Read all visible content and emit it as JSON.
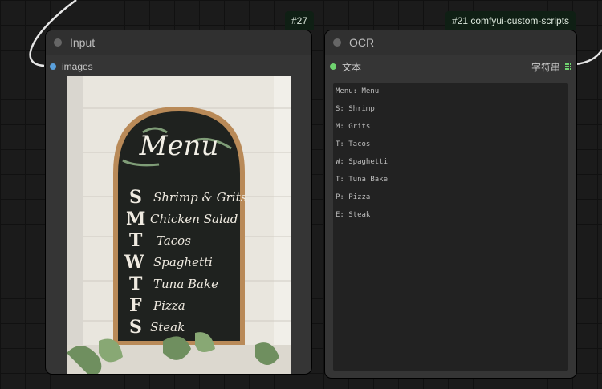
{
  "badges": {
    "input_id": "#27",
    "ocr_id": "#21 comfyui-custom-scripts"
  },
  "input_node": {
    "title": "Input",
    "output_slot": "images",
    "image": {
      "heading": "Menu",
      "days": [
        "S",
        "M",
        "T",
        "W",
        "T",
        "F",
        "S"
      ],
      "items": [
        "Shrimp & Grits",
        "Chicken Salad",
        "Tacos",
        "Spaghetti",
        "Tuna Bake",
        "Pizza",
        "Steak"
      ]
    }
  },
  "ocr_node": {
    "title": "OCR",
    "input_slot": "文本",
    "output_label": "字符串",
    "text_lines": [
      "Menu: Menu",
      "S: Shrimp",
      "M: Grits",
      "T: Tacos",
      "W: Spaghetti",
      "T: Tuna Bake",
      "P: Pizza",
      "E: Steak"
    ]
  },
  "colors": {
    "image_slot": "#5aa0dc",
    "text_slot": "#6fd36f",
    "node_body": "#353535"
  }
}
